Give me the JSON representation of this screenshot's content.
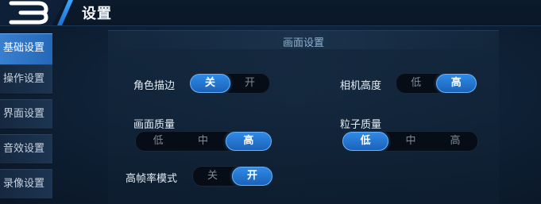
{
  "header": {
    "title": "设置"
  },
  "sidebar": {
    "items": [
      {
        "label": "基础设置",
        "active": true
      },
      {
        "label": "操作设置",
        "active": false
      },
      {
        "label": "界面设置",
        "active": false
      },
      {
        "label": "音效设置",
        "active": false
      },
      {
        "label": "录像设置",
        "active": false
      }
    ]
  },
  "main": {
    "section_title": "画面设置",
    "settings": {
      "outline": {
        "label": "角色描边",
        "options": [
          "关",
          "开"
        ],
        "selected": "关"
      },
      "camera_height": {
        "label": "相机高度",
        "options": [
          "低",
          "高"
        ],
        "selected": "高"
      },
      "quality": {
        "label": "画面质量",
        "options": [
          "低",
          "中",
          "高"
        ],
        "selected": "高"
      },
      "particles": {
        "label": "粒子质量",
        "options": [
          "低",
          "中",
          "高"
        ],
        "selected": "低"
      },
      "high_fps": {
        "label": "高帧率模式",
        "options": [
          "关",
          "开"
        ],
        "selected": "开"
      }
    }
  },
  "colors": {
    "accent": "#2f8ae6",
    "accent_border": "#6ab4ff",
    "background": "#0f2238"
  }
}
